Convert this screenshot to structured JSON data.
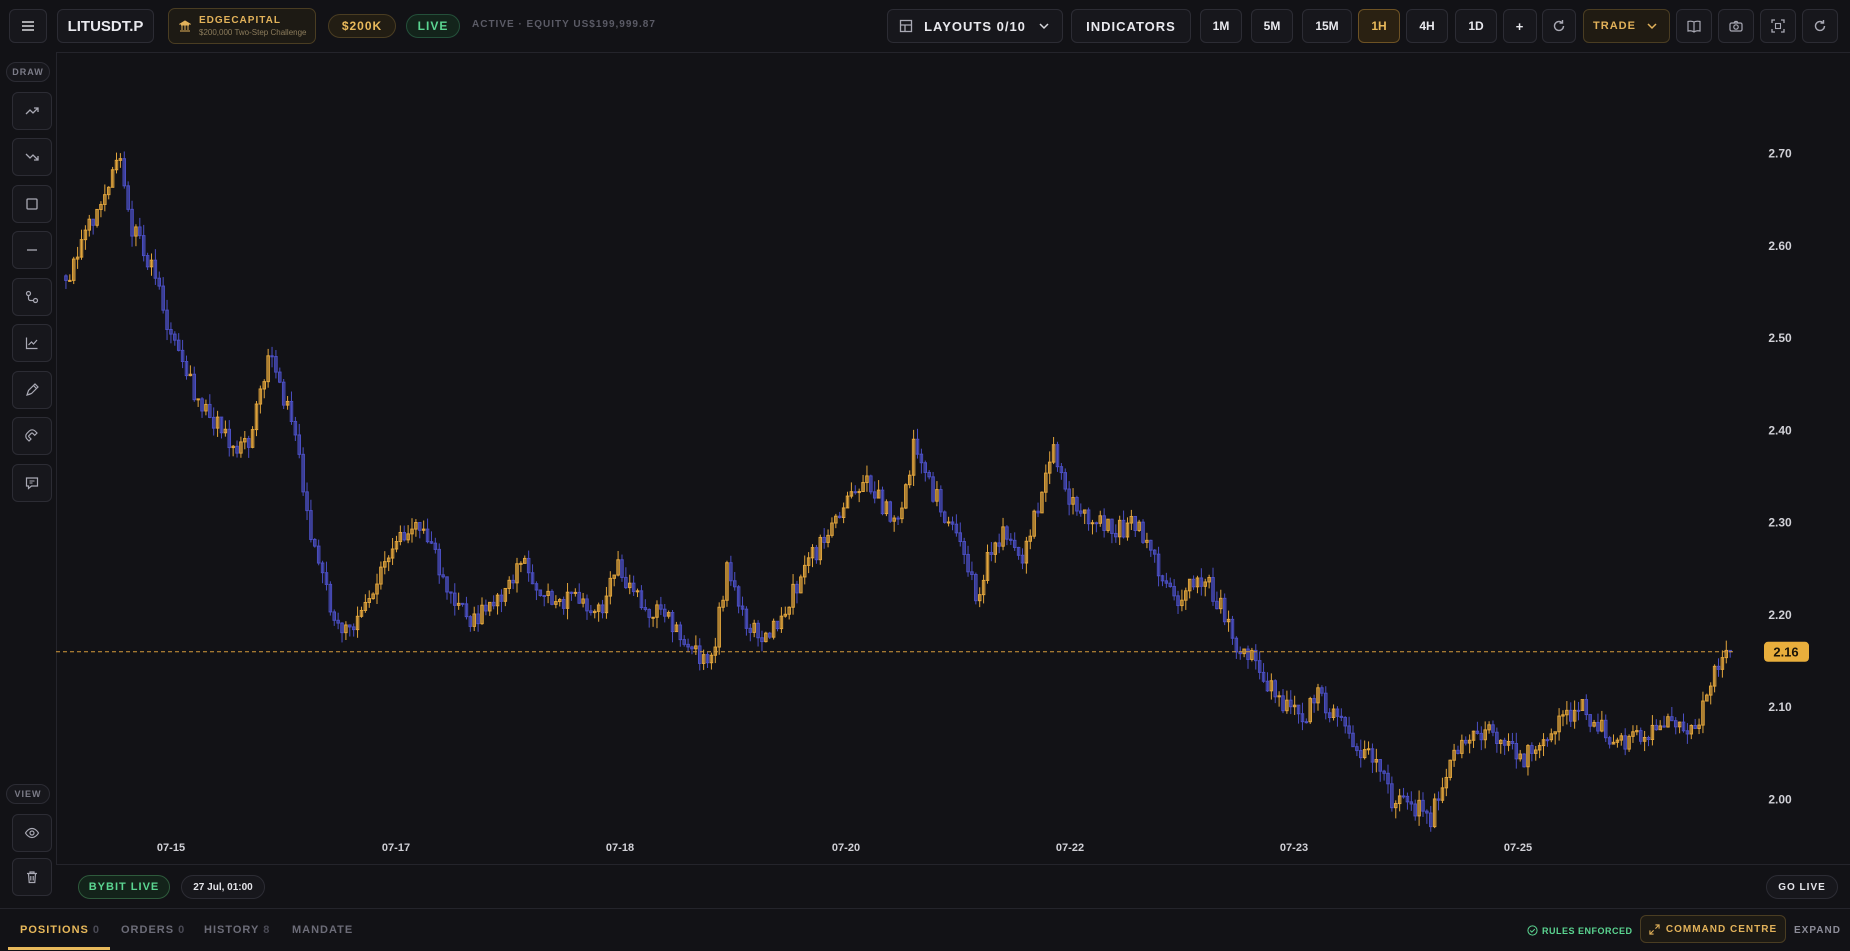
{
  "header": {
    "symbol": "LITUSDT.P",
    "account_name": "EDGECAPITAL",
    "account_desc": "$200,000 Two-Step Challenge",
    "account_size": "$200K",
    "live_badge": "LIVE",
    "status_text": "ACTIVE · EQUITY US$199,999.87",
    "layouts_label": "LAYOUTS 0/10",
    "indicators_label": "INDICATORS",
    "timeframes": [
      "1M",
      "5M",
      "15M",
      "1H",
      "4H",
      "1D"
    ],
    "active_timeframe": "1H",
    "add_label": "+",
    "trade_label": "TRADE"
  },
  "sidebar": {
    "draw_label": "DRAW",
    "view_label": "VIEW",
    "tools": [
      "trend-up-icon",
      "trend-down-icon",
      "rectangle-icon",
      "horizontal-line-icon",
      "path-icon",
      "line-chart-icon",
      "pen-icon",
      "magnet-icon",
      "comment-icon"
    ],
    "view_tools": [
      "eye-icon",
      "trash-icon"
    ]
  },
  "chart_data": {
    "type": "candlestick",
    "y_ticks": [
      "2.70",
      "2.60",
      "2.50",
      "2.40",
      "2.30",
      "2.20",
      "2.10",
      "2.00"
    ],
    "ylim": [
      1.93,
      2.81
    ],
    "x_ticks": [
      "07-15",
      "07-17",
      "07-18",
      "07-20",
      "07-22",
      "07-23",
      "07-25"
    ],
    "last_price": 2.16,
    "last_price_label": "2.16",
    "up_color": "#e2a53c",
    "down_color": "#4b4fc4",
    "price_line_color": "#d49a3a",
    "path": [
      [
        0,
        2.56
      ],
      [
        4,
        2.6
      ],
      [
        10,
        2.66
      ],
      [
        14,
        2.69
      ],
      [
        17,
        2.62
      ],
      [
        22,
        2.58
      ],
      [
        28,
        2.49
      ],
      [
        33,
        2.44
      ],
      [
        38,
        2.41
      ],
      [
        43,
        2.38
      ],
      [
        47,
        2.39
      ],
      [
        52,
        2.48
      ],
      [
        55,
        2.45
      ],
      [
        59,
        2.4
      ],
      [
        63,
        2.28
      ],
      [
        66,
        2.24
      ],
      [
        69,
        2.19
      ],
      [
        74,
        2.18
      ],
      [
        79,
        2.22
      ],
      [
        84,
        2.28
      ],
      [
        90,
        2.3
      ],
      [
        95,
        2.26
      ],
      [
        99,
        2.22
      ],
      [
        104,
        2.19
      ],
      [
        108,
        2.21
      ],
      [
        113,
        2.22
      ],
      [
        117,
        2.26
      ],
      [
        122,
        2.23
      ],
      [
        127,
        2.21
      ],
      [
        132,
        2.22
      ],
      [
        137,
        2.2
      ],
      [
        142,
        2.25
      ],
      [
        147,
        2.22
      ],
      [
        152,
        2.2
      ],
      [
        157,
        2.19
      ],
      [
        162,
        2.16
      ],
      [
        166,
        2.15
      ],
      [
        170,
        2.25
      ],
      [
        175,
        2.19
      ],
      [
        180,
        2.17
      ],
      [
        185,
        2.21
      ],
      [
        190,
        2.25
      ],
      [
        195,
        2.28
      ],
      [
        200,
        2.32
      ],
      [
        205,
        2.35
      ],
      [
        210,
        2.32
      ],
      [
        214,
        2.3
      ],
      [
        218,
        2.38
      ],
      [
        222,
        2.34
      ],
      [
        226,
        2.31
      ],
      [
        230,
        2.28
      ],
      [
        234,
        2.22
      ],
      [
        238,
        2.27
      ],
      [
        242,
        2.29
      ],
      [
        246,
        2.26
      ],
      [
        250,
        2.32
      ],
      [
        254,
        2.38
      ],
      [
        258,
        2.33
      ],
      [
        262,
        2.31
      ],
      [
        266,
        2.3
      ],
      [
        270,
        2.29
      ],
      [
        274,
        2.3
      ],
      [
        278,
        2.28
      ],
      [
        282,
        2.23
      ],
      [
        286,
        2.22
      ],
      [
        290,
        2.24
      ],
      [
        294,
        2.23
      ],
      [
        298,
        2.2
      ],
      [
        302,
        2.16
      ],
      [
        306,
        2.15
      ],
      [
        310,
        2.12
      ],
      [
        314,
        2.1
      ],
      [
        318,
        2.09
      ],
      [
        322,
        2.11
      ],
      [
        326,
        2.09
      ],
      [
        330,
        2.07
      ],
      [
        334,
        2.05
      ],
      [
        338,
        2.04
      ],
      [
        341,
        2.0
      ],
      [
        345,
        1.99
      ],
      [
        348,
        1.99
      ],
      [
        351,
        1.98
      ],
      [
        354,
        2.02
      ],
      [
        358,
        2.05
      ],
      [
        362,
        2.07
      ],
      [
        366,
        2.08
      ],
      [
        370,
        2.06
      ],
      [
        374,
        2.04
      ],
      [
        378,
        2.06
      ],
      [
        382,
        2.08
      ],
      [
        386,
        2.09
      ],
      [
        390,
        2.1
      ],
      [
        394,
        2.08
      ],
      [
        398,
        2.06
      ],
      [
        402,
        2.06
      ],
      [
        406,
        2.07
      ],
      [
        410,
        2.09
      ],
      [
        414,
        2.08
      ],
      [
        418,
        2.07
      ],
      [
        421,
        2.1
      ],
      [
        424,
        2.14
      ],
      [
        428,
        2.16
      ]
    ]
  },
  "footer": {
    "feed_label": "BYBIT LIVE",
    "datetime_label": "27 Jul, 01:00",
    "golive_label": "GO LIVE"
  },
  "bottom": {
    "tabs": [
      {
        "label": "POSITIONS",
        "count": "0"
      },
      {
        "label": "ORDERS",
        "count": "0"
      },
      {
        "label": "HISTORY",
        "count": "8"
      },
      {
        "label": "MANDATE",
        "count": ""
      }
    ],
    "rules_label": "RULES ENFORCED",
    "command_label": "COMMAND CENTRE",
    "expand_label": "EXPAND"
  }
}
